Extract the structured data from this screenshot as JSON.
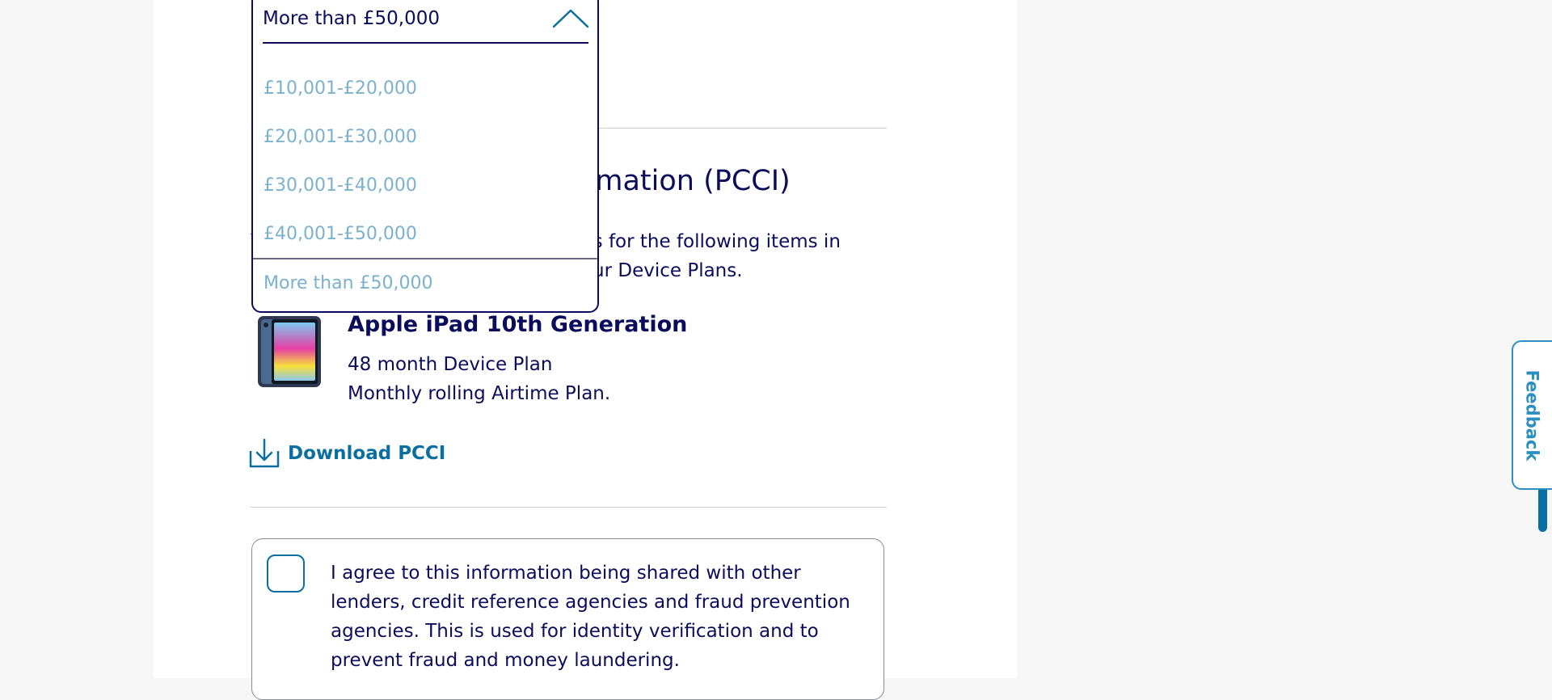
{
  "dropdown": {
    "selected_value": "More than £50,000",
    "options": [
      {
        "label": "£10,001-£20,000"
      },
      {
        "label": "£20,001-£30,000"
      },
      {
        "label": "£30,001-£40,000"
      },
      {
        "label": "£40,001-£50,000"
      },
      {
        "label": "More than £50,000"
      }
    ]
  },
  "pcci": {
    "heading": "Pre-Contract Credit Information (PCCI)",
    "intro": "You can download and save the PCCIs for the following items in your basket. These are specific to your Device Plans.",
    "device": {
      "title": "Apple iPad 10th Generation",
      "plan_line": "48 month Device Plan",
      "airtime_line": "Monthly rolling Airtime Plan."
    },
    "download_label": "Download PCCI"
  },
  "consent": {
    "text": "I agree to this information being shared with other lenders, credit reference agencies and fraud prevention agencies. This is used for identity verification and to prevent fraud and money laundering."
  },
  "feedback": {
    "label": "Feedback"
  },
  "colors": {
    "navy": "#0b0c5c",
    "link_blue": "#0a6ea0",
    "option_muted": "#7bb1cc",
    "feedback_blue": "#2b8fc0"
  },
  "icons": {
    "chevron": "chevron-up-icon",
    "download": "download-icon"
  }
}
